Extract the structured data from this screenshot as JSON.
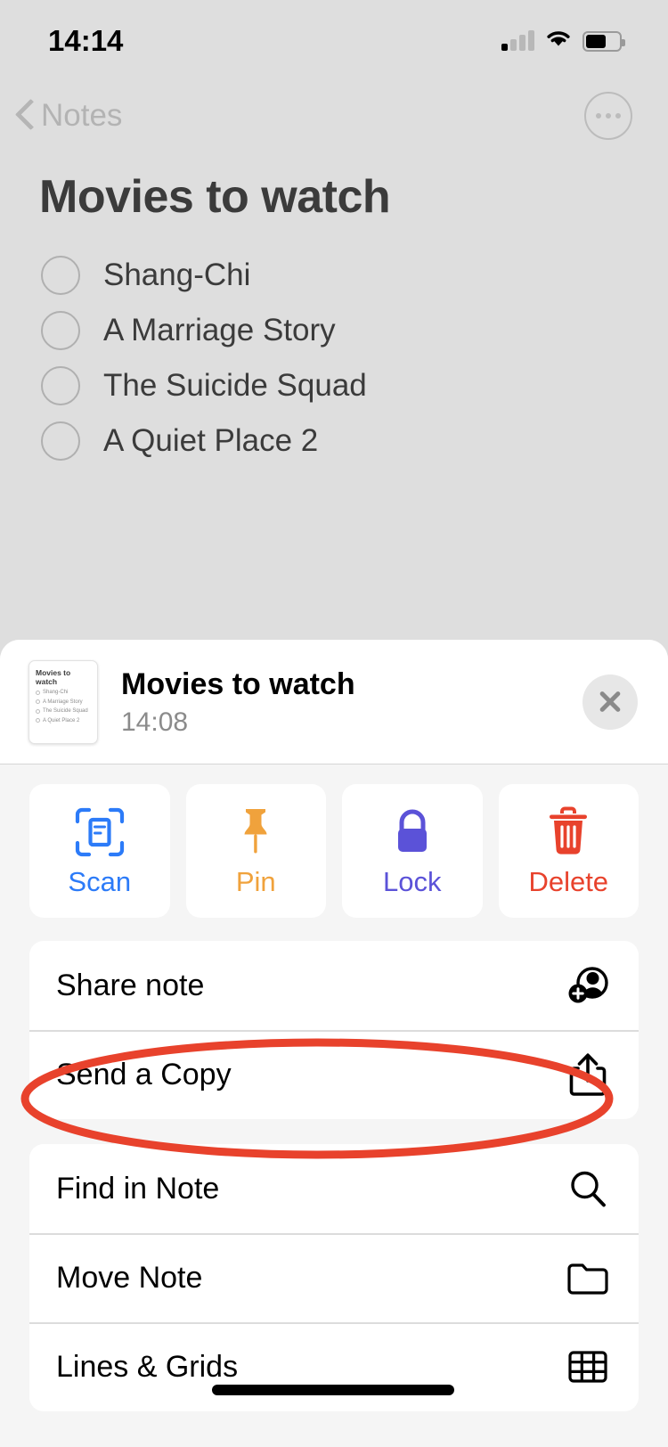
{
  "status_bar": {
    "time": "14:14",
    "signal_icon": "cellular-signal-icon",
    "wifi_icon": "wifi-icon",
    "battery_icon": "battery-icon"
  },
  "nav": {
    "back_label": "Notes",
    "back_icon": "chevron-left-icon",
    "more_icon": "ellipsis-circle-icon"
  },
  "note": {
    "title": "Movies to watch",
    "items": [
      {
        "label": "Shang-Chi",
        "checked": false
      },
      {
        "label": "A Marriage Story",
        "checked": false
      },
      {
        "label": "The Suicide Squad",
        "checked": false
      },
      {
        "label": "A Quiet Place 2",
        "checked": false
      }
    ]
  },
  "sheet": {
    "preview_title": "Movies to watch",
    "preview_time": "14:08",
    "close_icon": "close-icon",
    "thumbnail": {
      "title": "Movies to watch",
      "items": [
        "Shang-Chi",
        "A Marriage Story",
        "The Suicide Squad",
        "A Quiet Place 2"
      ]
    },
    "tiles": [
      {
        "label": "Scan",
        "icon": "scan-document-icon",
        "color": "#2c7bf8"
      },
      {
        "label": "Pin",
        "icon": "pin-icon",
        "color": "#f0a23c"
      },
      {
        "label": "Lock",
        "icon": "lock-icon",
        "color": "#5b52d8"
      },
      {
        "label": "Delete",
        "icon": "trash-icon",
        "color": "#e8422c"
      }
    ],
    "group_one": [
      {
        "label": "Share note",
        "icon": "person-add-icon"
      },
      {
        "label": "Send a Copy",
        "icon": "share-upload-icon"
      }
    ],
    "group_two": [
      {
        "label": "Find in Note",
        "icon": "magnifier-icon"
      },
      {
        "label": "Move Note",
        "icon": "folder-icon"
      },
      {
        "label": "Lines & Grids",
        "icon": "grid-icon"
      }
    ]
  },
  "annotation": {
    "target_label": "Send a Copy",
    "shape": "ellipse",
    "color": "#e8422c"
  },
  "colors": {
    "page_background": "#dedede",
    "sheet_background": "#f5f5f5",
    "card_background": "#ffffff",
    "text_primary": "#000000",
    "text_note": "#3b3b3b",
    "text_secondary": "#8b8b8b"
  }
}
